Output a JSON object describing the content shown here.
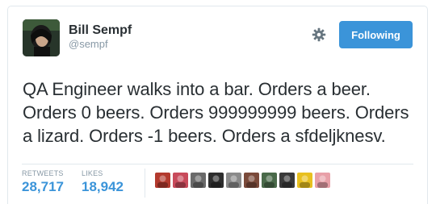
{
  "user": {
    "full_name": "Bill Sempf",
    "screen_name": "@sempf"
  },
  "header": {
    "follow_label": "Following",
    "settings_icon": "gear-icon"
  },
  "tweet": {
    "text": "QA Engineer walks into a bar. Orders a beer. Orders 0 beers. Orders 999999999 beers. Orders a lizard. Orders -1 beers. Orders a sfdeljknesv."
  },
  "stats": {
    "retweets_label": "RETWEETS",
    "retweets_value": "28,717",
    "likes_label": "LIKES",
    "likes_value": "18,942"
  },
  "colors": {
    "accent": "#3b94d9",
    "muted": "#8899a6",
    "text": "#292f33",
    "border": "#e1e8ed"
  },
  "likers": [
    {
      "icon": "liker-avatar-1",
      "color": "#b33a2e"
    },
    {
      "icon": "liker-avatar-2",
      "color": "#c84a5a"
    },
    {
      "icon": "liker-avatar-3",
      "color": "#6a6a6a"
    },
    {
      "icon": "liker-avatar-4",
      "color": "#2e2e2e"
    },
    {
      "icon": "liker-avatar-5",
      "color": "#8a8a8a"
    },
    {
      "icon": "liker-avatar-6",
      "color": "#7a4a3a"
    },
    {
      "icon": "liker-avatar-7",
      "color": "#4a6a4a"
    },
    {
      "icon": "liker-avatar-8",
      "color": "#3a3a3a"
    },
    {
      "icon": "liker-avatar-9",
      "color": "#e8c020"
    },
    {
      "icon": "liker-avatar-10",
      "color": "#e8a0a8"
    }
  ]
}
